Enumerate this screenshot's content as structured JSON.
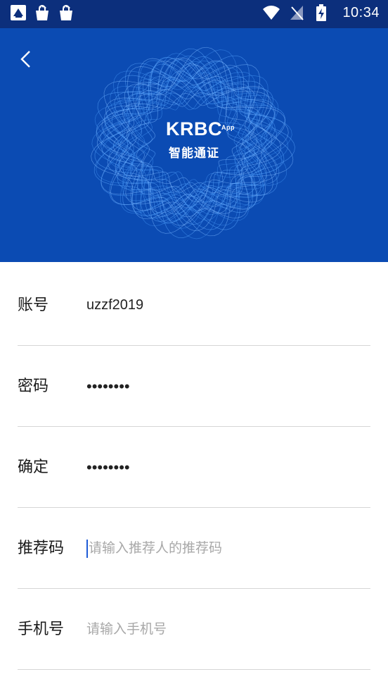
{
  "status_bar": {
    "time": "10:34",
    "left_icons": [
      "app-notification-icon",
      "shopping-bag-icon",
      "shopping-bag-icon"
    ],
    "right_icons": [
      "wifi-icon",
      "no-signal-icon",
      "battery-charging-icon"
    ]
  },
  "header": {
    "brand_name": "KRBC",
    "brand_superscript": "App",
    "brand_subtitle": "智能通证",
    "colors": {
      "background": "#0b4bb3",
      "status_bar": "#0c2f7c"
    }
  },
  "form": {
    "fields": [
      {
        "label": "账号",
        "value": "uzzf2019",
        "placeholder": ""
      },
      {
        "label": "密码",
        "value": "••••••••",
        "placeholder": ""
      },
      {
        "label": "确定",
        "value": "••••••••",
        "placeholder": ""
      },
      {
        "label": "推荐码",
        "value": "",
        "placeholder": "请输入推荐人的推荐码"
      },
      {
        "label": "手机号",
        "value": "",
        "placeholder": "请输入手机号"
      }
    ]
  }
}
